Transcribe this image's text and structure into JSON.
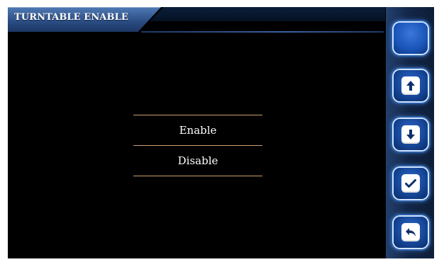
{
  "window": {
    "title": "TURNTABLE ENABLE"
  },
  "options": [
    {
      "label": "Enable"
    },
    {
      "label": "Disable"
    }
  ],
  "sidebar": {
    "buttons": [
      {
        "name": "blank-button",
        "icon": ""
      },
      {
        "name": "up-button",
        "icon": "arrow-up-icon"
      },
      {
        "name": "down-button",
        "icon": "arrow-down-icon"
      },
      {
        "name": "confirm-button",
        "icon": "checkmark-icon"
      },
      {
        "name": "back-button",
        "icon": "return-arrow-icon"
      }
    ]
  },
  "colors": {
    "accent": "#2c4f86",
    "divider": "#c9a06b",
    "button": "#144494"
  }
}
